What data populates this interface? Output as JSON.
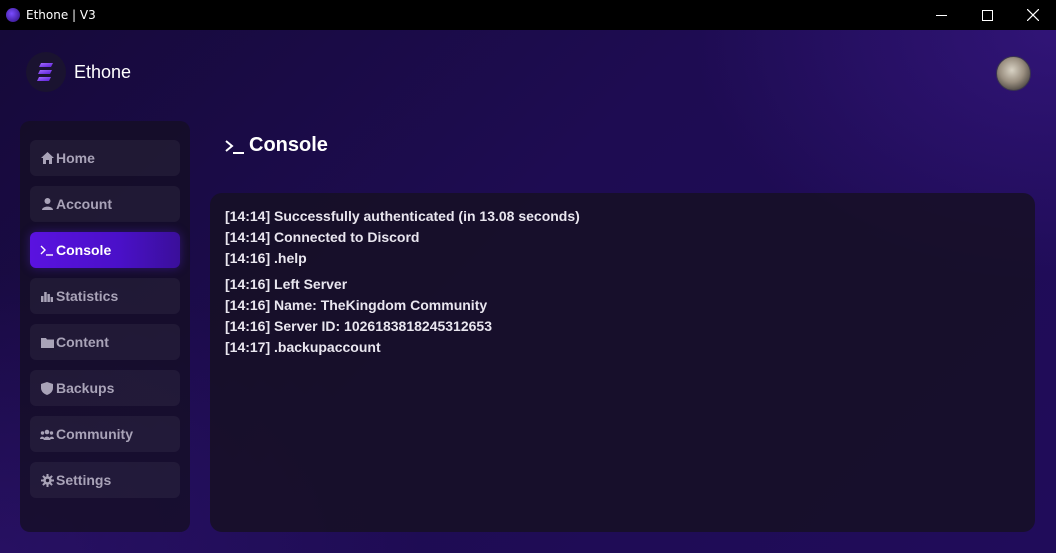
{
  "window": {
    "title": "Ethone | V3",
    "minimize_glyph": "—",
    "maximize_glyph": "☐",
    "close_glyph": "✕"
  },
  "brand": {
    "name": "Ethone",
    "logo_icon": "ethone-logo-icon"
  },
  "profile": {
    "avatar_icon": "user-avatar"
  },
  "sidebar": {
    "items": [
      {
        "label": "Home",
        "icon": "home-icon",
        "active": false
      },
      {
        "label": "Account",
        "icon": "user-icon",
        "active": false
      },
      {
        "label": "Console",
        "icon": "terminal-icon",
        "active": true
      },
      {
        "label": "Statistics",
        "icon": "bar-chart-icon",
        "active": false
      },
      {
        "label": "Content",
        "icon": "folder-icon",
        "active": false
      },
      {
        "label": "Backups",
        "icon": "shield-icon",
        "active": false
      },
      {
        "label": "Community",
        "icon": "users-icon",
        "active": false
      },
      {
        "label": "Settings",
        "icon": "gear-icon",
        "active": false
      }
    ]
  },
  "main": {
    "title": "Console",
    "title_icon": "terminal-icon"
  },
  "console": {
    "lines": [
      "[14:14] Successfully authenticated (in 13.08 seconds)",
      "[14:14] Connected to Discord",
      "[14:16] .help",
      "[14:16] Left Server",
      "[14:16] Name: TheKingdom Community",
      "[14:16] Server ID: 1026183818245312653",
      "[14:17] .backupaccount"
    ]
  },
  "colors": {
    "accent": "#5a12e0",
    "background": "#1a0b45",
    "panel": "#161022",
    "text": "#e9e6ef",
    "muted_text": "#a9a3b8"
  }
}
